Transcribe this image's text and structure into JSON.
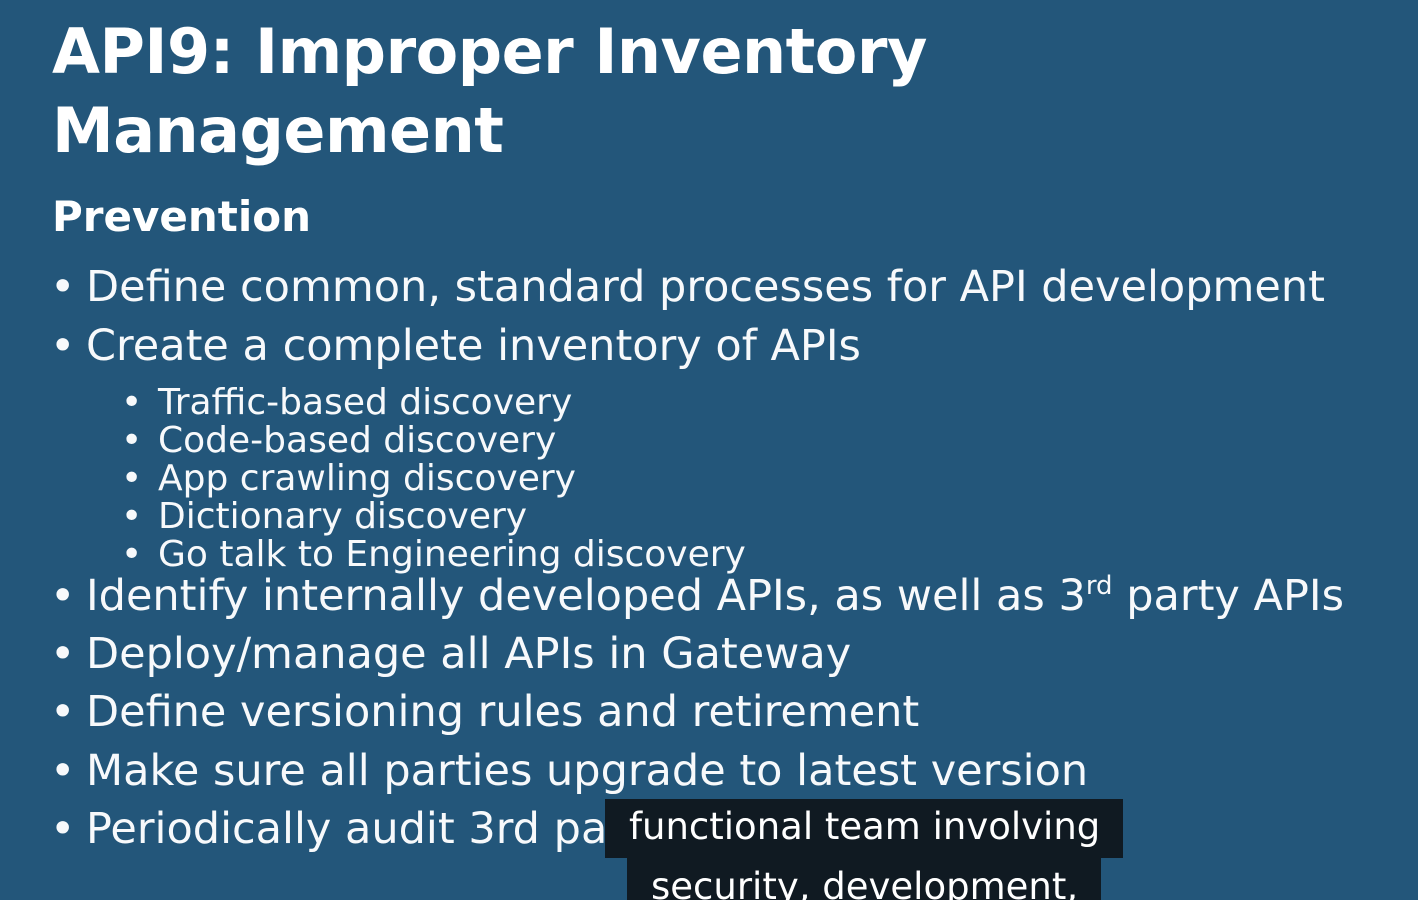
{
  "slide": {
    "title_line1": "API9: Improper Inventory",
    "title_line2": "Management",
    "subheading": "Prevention",
    "bullet_char": "•",
    "bullets": [
      "Define common, standard processes for API development",
      "Create a complete inventory of APIs",
      "Identify internally developed APIs, as well as 3",
      "Deploy/manage all APIs in Gateway",
      "Define versioning rules and retirement",
      "Make sure all parties upgrade to latest version",
      "Periodically audit 3rd pa"
    ],
    "bullet3_superscript": "rd",
    "bullet3_suffix": " party APIs",
    "sub_bullets": [
      "Traffic-based discovery",
      "Code-based discovery",
      "App crawling discovery",
      "Dictionary discovery",
      "Go talk to Engineering discovery"
    ]
  },
  "captions": {
    "line1": "functional team involving",
    "line2": "security, development,"
  },
  "colors": {
    "background": "#23567a",
    "text": "#f7f9fb",
    "caption_background": "#101a22"
  }
}
